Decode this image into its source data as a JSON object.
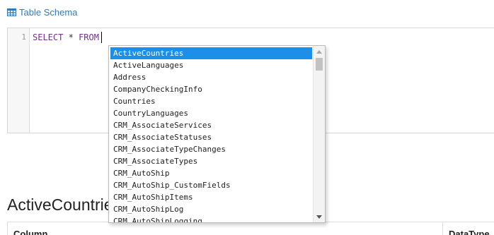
{
  "header": {
    "schema_link": "Table Schema",
    "schema_icon": "table-icon"
  },
  "editor": {
    "line_number": "1",
    "keyword_select": "SELECT",
    "star": "*",
    "keyword_from": "FROM"
  },
  "autocomplete": {
    "selected": "ActiveCountries",
    "items": [
      "ActiveCountries",
      "ActiveLanguages",
      "Address",
      "CompanyCheckingInfo",
      "Countries",
      "CountryLanguages",
      "CRM_AssociateServices",
      "CRM_AssociateStatuses",
      "CRM_AssociateTypeChanges",
      "CRM_AssociateTypes",
      "CRM_AutoShip",
      "CRM_AutoShip_CustomFields",
      "CRM_AutoShipItems",
      "CRM_AutoShipLog",
      "CRM_AutoShipLogging"
    ]
  },
  "section": {
    "title": "ActiveCountries"
  },
  "table": {
    "columns": [
      "Column",
      "DataType"
    ]
  }
}
